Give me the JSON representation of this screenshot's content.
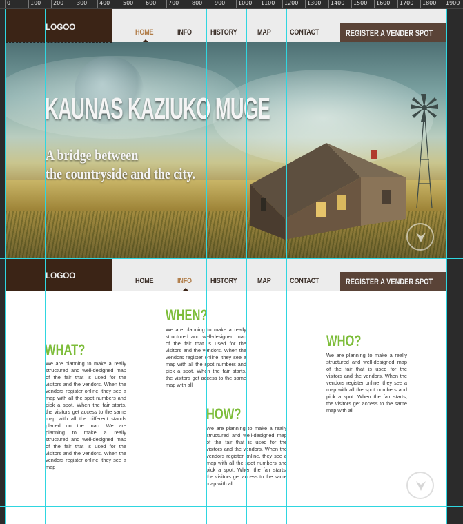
{
  "ruler": {
    "ticks": [
      "0",
      "100",
      "200",
      "300",
      "400",
      "500",
      "600",
      "700",
      "800",
      "900",
      "1000",
      "1100",
      "1200",
      "1300",
      "1400",
      "1500",
      "1600",
      "1700",
      "1800",
      "1900"
    ]
  },
  "header_top": {
    "logo": "LOGOO",
    "nav": [
      "HOME",
      "INFO",
      "HISTORY",
      "MAP",
      "CONTACT"
    ],
    "active": "HOME",
    "register": "REGISTER A VENDER SPOT"
  },
  "hero": {
    "title": "KAUNAS KAZIUKO MUGE",
    "subtitle_line1": "A bridge between",
    "subtitle_line2": "the countryside and the city."
  },
  "header_second": {
    "logo": "LOGOO",
    "nav": [
      "HOME",
      "INFO",
      "HISTORY",
      "MAP",
      "CONTACT"
    ],
    "active": "INFO",
    "register": "REGISTER A VENDER SPOT"
  },
  "content": {
    "what": {
      "heading": "WHAT?",
      "text": "We are planning to make a really structured and well-designed map of the fair that is used for the visitors and the vendors. When the vendors register online, they see a map with all the spot numbers and pick a spot. When the fair starts, the visitors get access to the same map with all the different stands placed on the map. We are planning to make a really structured and well-designed map of the fair that is used for the visitors and the vendors. When the vendors register online, they see a map"
    },
    "when": {
      "heading": "WHEN?",
      "text": "We are planning to make a really structured and well-designed map of the fair that is used for the visitors and the vendors. When the vendors register online, they see a map with all the spot numbers and pick a spot. When the fair starts, the visitors get access to the same map with all"
    },
    "how": {
      "heading": "HOW?",
      "text": "We are planning to make a really structured and well-designed map of the fair that is used for the visitors and the vendors. When the vendors register online, they see a map with all the spot numbers and pick a spot. When the fair starts, the visitors get access to the same map with all"
    },
    "who": {
      "heading": "WHO?",
      "text": "We are planning to make a really structured and well-designed map of the fair that is used for the visitors and the vendors. When the vendors register online, they see a map with all the spot numbers and pick a spot. When the fair starts, the visitors get access to the same map with all"
    }
  },
  "colors": {
    "accent_green": "#7dbd3a",
    "logo_bg": "#3b2416",
    "nav_active": "#b07c47",
    "register_bg": "#5a4337",
    "guide": "#2fd6e0"
  }
}
